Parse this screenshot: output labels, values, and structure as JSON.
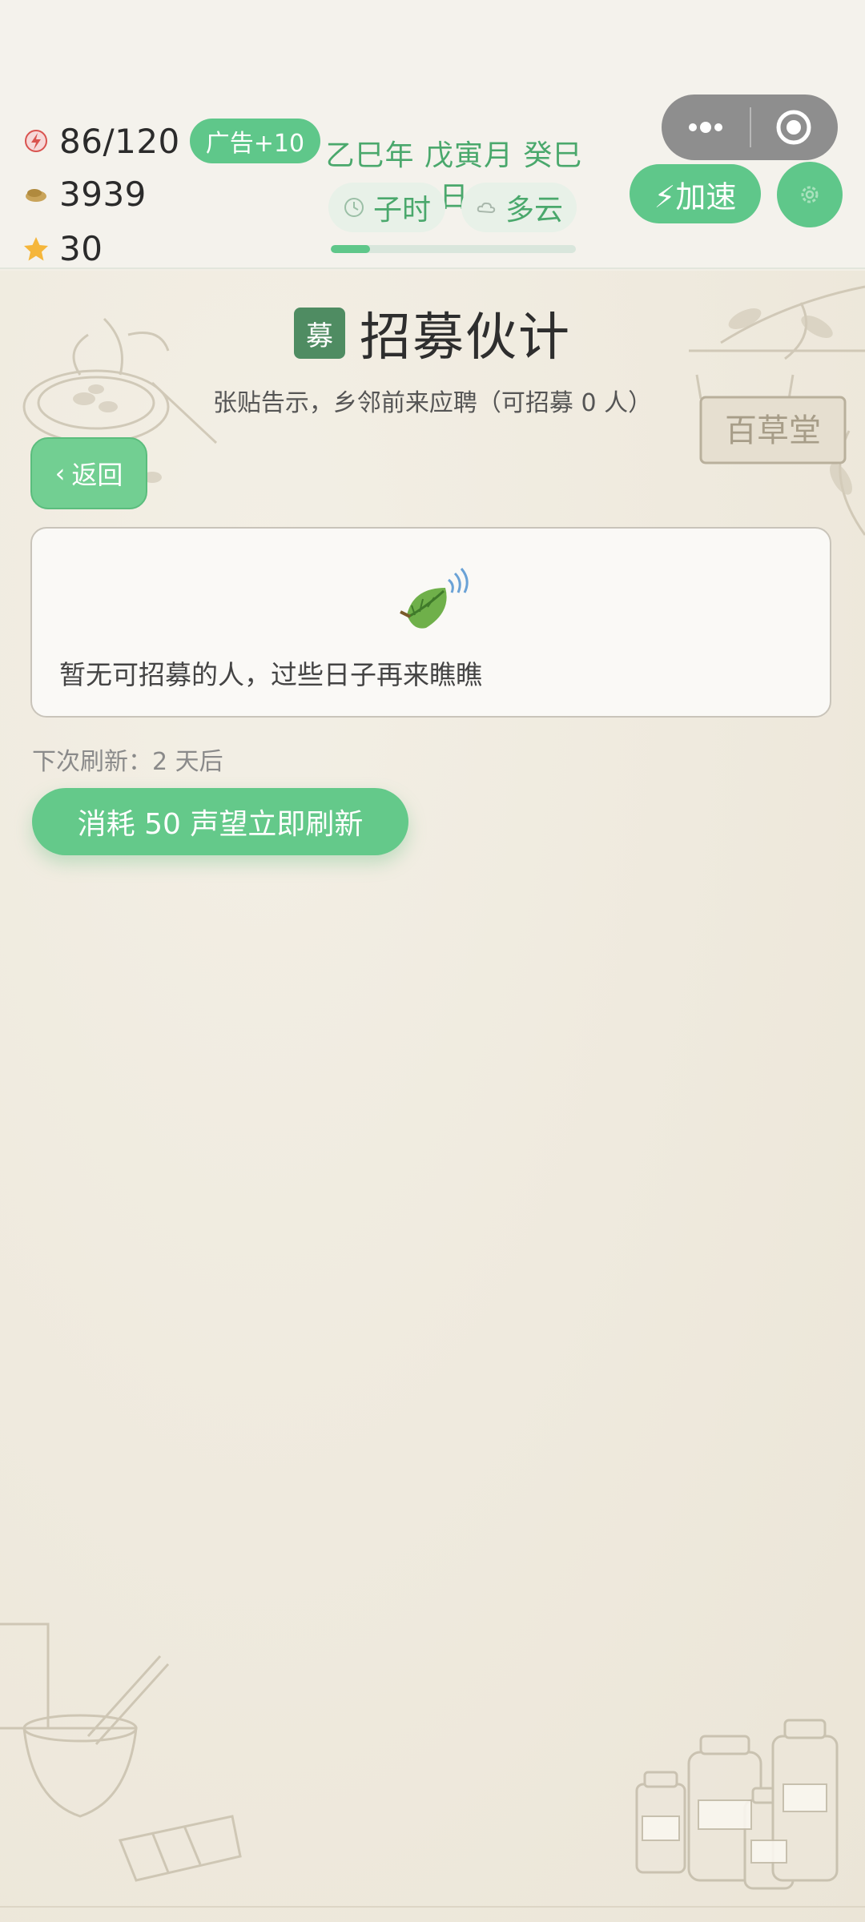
{
  "resources": {
    "stamina": "86/120",
    "ad_label": "广告+10",
    "coins": "3939",
    "reputation": "30"
  },
  "calendar": {
    "date": "乙巳年 戊寅月 癸巳日",
    "time_label": "子时",
    "weather_label": "多云",
    "day_progress": 0.16
  },
  "controls": {
    "speed_label": "⚡加速"
  },
  "page": {
    "title_badge": "募",
    "title": "招募伙计",
    "subtitle": "张贴告示，乡邻前来应聘（可招募 0 人）",
    "back_label": "返回",
    "empty_message": "暂无可招募的人，过些日子再来瞧瞧",
    "next_refresh": "下次刷新：2 天后",
    "refresh_button": "消耗 50 声望立即刷新"
  },
  "decor": {
    "signboard_text": "百草堂"
  },
  "colors": {
    "accent_green": "#5fc78a",
    "badge_dark_green": "#4f8c62",
    "date_green": "#4aa86c"
  },
  "icons": {
    "stamina": "stamina-icon",
    "coins": "coin-icon",
    "reputation": "star-icon",
    "time": "clock-icon",
    "weather": "cloud-icon",
    "settings": "gear-icon",
    "empty": "leaf-icon"
  }
}
